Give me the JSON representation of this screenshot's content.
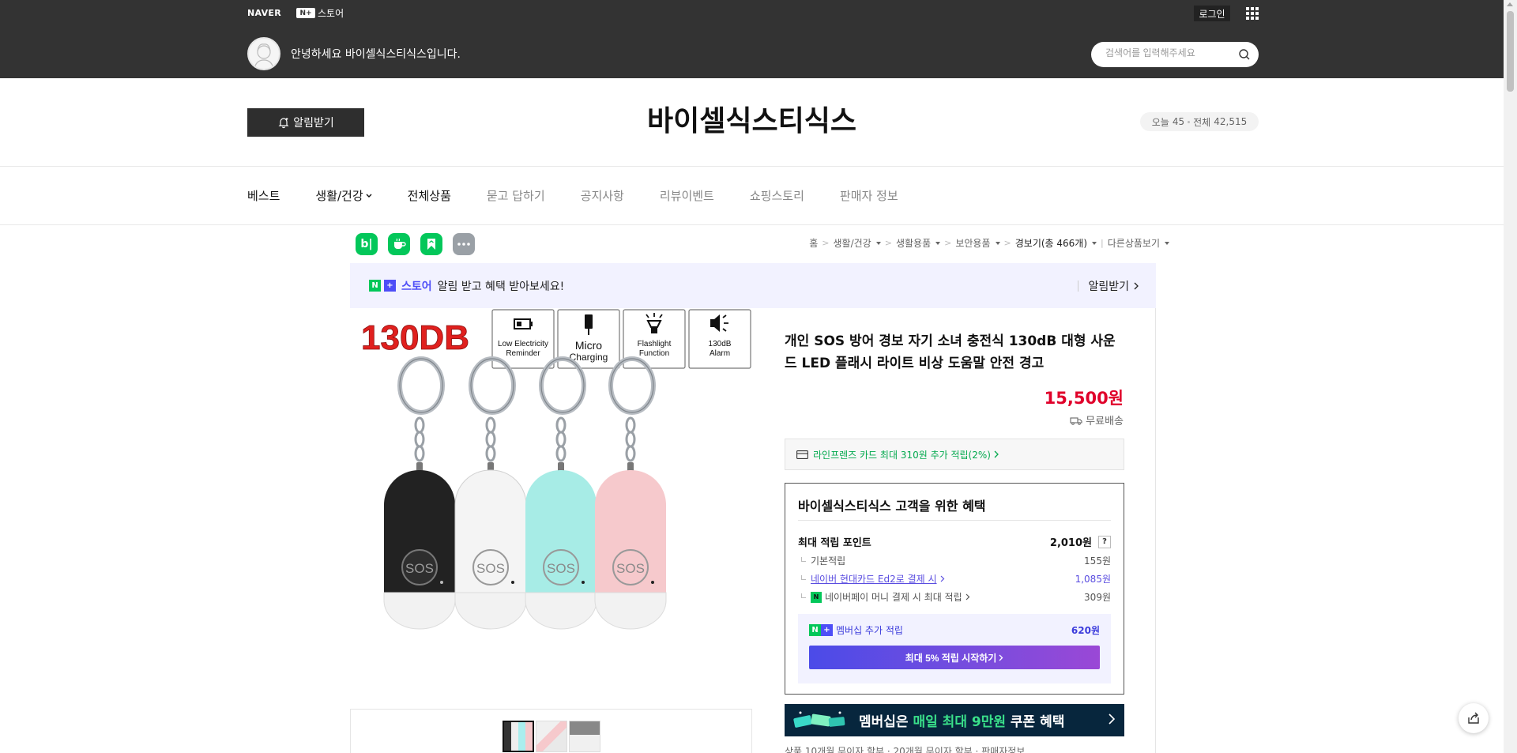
{
  "topbar": {
    "naver_logo": "NAVER",
    "store_badge": "N+",
    "store_label": "스토어",
    "login": "로그인",
    "greeting": "안녕하세요 바이셀식스티식스입니다.",
    "search_placeholder": "검색어를 입력해주세요",
    "bg_color": "#333333"
  },
  "header": {
    "alarm_button": "알림받기",
    "store_name": "바이셀식스티식스",
    "visits_today_label": "오늘",
    "visits_today": "45",
    "visits_total_label": "전체",
    "visits_total": "42,515"
  },
  "nav": {
    "items": [
      {
        "label": "베스트",
        "style": "dark"
      },
      {
        "label": "생활/건강",
        "style": "dark",
        "dropdown": true
      },
      {
        "label": "전체상품",
        "style": "dark"
      },
      {
        "label": "묻고 답하기",
        "style": "light"
      },
      {
        "label": "공지사항",
        "style": "light"
      },
      {
        "label": "리뷰이벤트",
        "style": "light"
      },
      {
        "label": "쇼핑스토리",
        "style": "light"
      },
      {
        "label": "판매자 정보",
        "style": "light"
      }
    ]
  },
  "share": {
    "icons": [
      "band-icon",
      "talk-icon",
      "bookmark-icon",
      "more-icon"
    ],
    "band_text": "b|"
  },
  "breadcrumb": {
    "items": [
      "홈",
      "생활/건강",
      "생활용품",
      "보안용품",
      "경보기(총 466개)",
      "다른상품보기"
    ]
  },
  "promo": {
    "badge": "N+",
    "store": "스토어",
    "message": "알림 받고 혜택 받아보세요!",
    "cta": "알림받기"
  },
  "product_image": {
    "headline": "130DB",
    "features": [
      {
        "icon": "battery-icon",
        "label_1": "Low Electricity",
        "label_2": "Reminder"
      },
      {
        "icon": "usb-cable-icon",
        "label_1": "Micro",
        "label_2": "Charging"
      },
      {
        "icon": "flashlight-icon",
        "label_1": "Flashlight",
        "label_2": "Function"
      },
      {
        "icon": "speaker-icon",
        "label_1": "130dB",
        "label_2": "Alarm"
      }
    ],
    "device_colors": [
      "#222222",
      "#f4f4f4",
      "#a7ece6",
      "#f6c9cc"
    ],
    "device_label": "SOS",
    "thumbnails": 3
  },
  "product": {
    "title": "개인 SOS 방어 경보 자기 소녀 충전식 130dB 대형 사운드 LED 플래시 라이트 비상 도움말 안전 경고",
    "price": "15,500원",
    "shipping": "무료배송",
    "card_promo": "라인프렌즈 카드 최대 310원 추가 적립(2%)"
  },
  "benefits": {
    "title": "바이셀식스티식스 고객을 위한 혜택",
    "max_points_label": "최대 적립 포인트",
    "max_points": "2,010원",
    "help": "?",
    "rows": [
      {
        "label": "기본적립",
        "value": "155원",
        "link": false
      },
      {
        "label": "네이버 현대카드 Ed2로 결제 시",
        "value": "1,085원",
        "link": true
      },
      {
        "label": "네이버페이 머니 결제 시 최대 적립",
        "value": "309원",
        "link": false
      }
    ],
    "npay_badge": "N",
    "membership_label": "멤버십 추가 적립",
    "membership_value": "620원",
    "membership_cta": "최대 5% 적립 시작하기"
  },
  "banner": {
    "text_pre": "멤버십은 ",
    "text_hl": "매일 최대 9만원",
    "text_post": " 쿠폰 혜택"
  },
  "footer_snippet": "상품 10개월 무이자 할부 · 20개월 무이자 할부 · 판매자정보"
}
